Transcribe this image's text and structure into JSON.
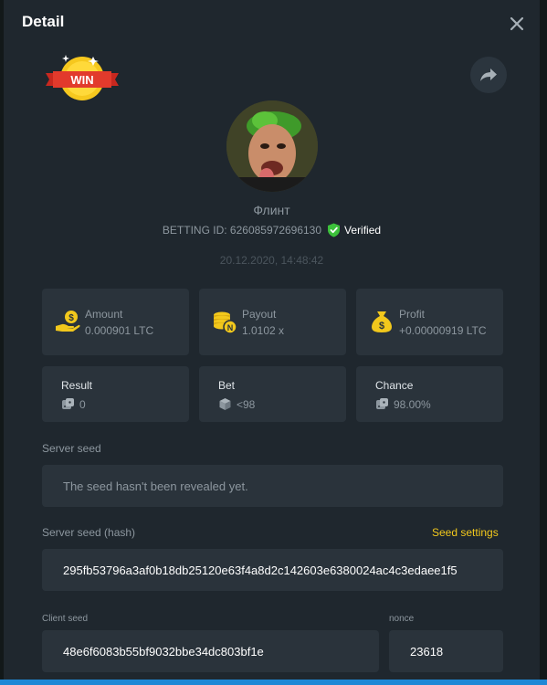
{
  "header": {
    "title": "Detail"
  },
  "badge": {
    "win_text": "WIN"
  },
  "player": {
    "name": "Флинт",
    "betting_id_label": "BETTING ID: 626085972696130",
    "verified_label": "Verified",
    "datetime": "20.12.2020, 14:48:42"
  },
  "stats": {
    "amount": {
      "label": "Amount",
      "value": "0.000901 LTC",
      "icon": "money-hand-icon"
    },
    "payout": {
      "label": "Payout",
      "value": "1.0102 x",
      "icon": "coins-stack-icon"
    },
    "profit": {
      "label": "Profit",
      "value": "+0.00000919 LTC",
      "icon": "money-bag-icon"
    }
  },
  "result_row": {
    "result": {
      "label": "Result",
      "value": "0",
      "icon": "dice-icon"
    },
    "bet": {
      "label": "Bet",
      "value": "<98",
      "icon": "cube-icon"
    },
    "chance": {
      "label": "Chance",
      "value": "98.00%",
      "icon": "dice-icon"
    }
  },
  "server_seed": {
    "label": "Server seed",
    "value": "The seed hasn't been revealed yet."
  },
  "server_seed_hash": {
    "label": "Server seed (hash)",
    "settings_link": "Seed settings",
    "value": "295fb53796a3af0b18db25120e63f4a8d2c142603e6380024ac4c3edaee1f5"
  },
  "client_seed": {
    "label": "Client seed",
    "value": "48e6f6083b55bf9032bbe34dc803bf1e"
  },
  "nonce": {
    "label": "nonce",
    "value": "23618"
  },
  "colors": {
    "background": "#1f272e",
    "card": "#2a333b",
    "accent_yellow": "#f2c81c",
    "verified_green": "#3cc13b",
    "muted_text": "#8d979f"
  }
}
